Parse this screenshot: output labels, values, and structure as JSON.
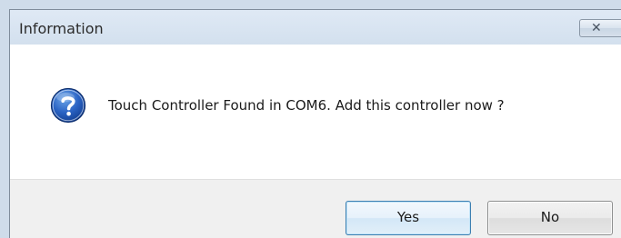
{
  "window": {
    "title": "Information",
    "close_icon": "close-icon",
    "colors": {
      "titlebar": "#d5e2f0",
      "content_background": "#ffffff",
      "button_area": "#f0f0f0",
      "default_button_border": "#3c7fb1"
    }
  },
  "message": {
    "icon": "question-icon",
    "text": "Touch Controller Found in COM6. Add this controller now ?"
  },
  "buttons": {
    "yes_label": "Yes",
    "no_label": "No",
    "default": "yes"
  }
}
